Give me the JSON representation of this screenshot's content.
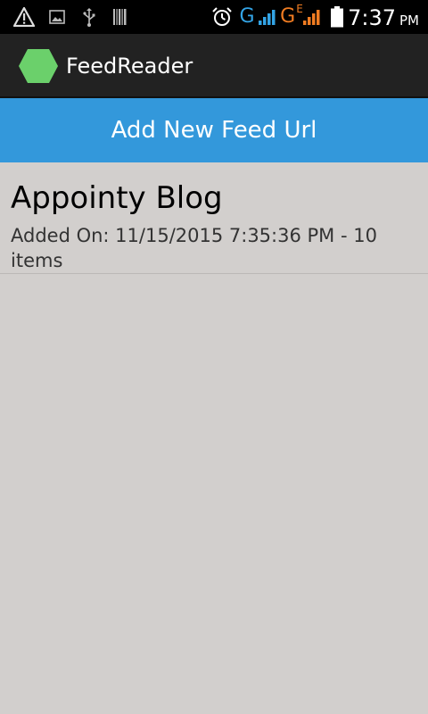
{
  "status_bar": {
    "time": "7:37",
    "ampm": "PM",
    "network_1": "G",
    "network_2": "G",
    "network_2_sup": "E",
    "icons": [
      "warning-icon",
      "image-icon",
      "usb-icon",
      "barcode-icon",
      "alarm-icon",
      "signal-icon",
      "signal-icon",
      "battery-icon"
    ],
    "colors": {
      "network_1": "#33a4e6",
      "network_2": "#f07c22"
    }
  },
  "action_bar": {
    "title": "FeedReader",
    "icon": "hexagon-app-icon",
    "icon_color": "#6bd06b"
  },
  "add_button": {
    "label": "Add New Feed Url",
    "color": "#3398db"
  },
  "feeds": [
    {
      "title": "Appointy Blog",
      "meta": "Added On: 11/15/2015 7:35:36 PM - 10 items"
    }
  ]
}
